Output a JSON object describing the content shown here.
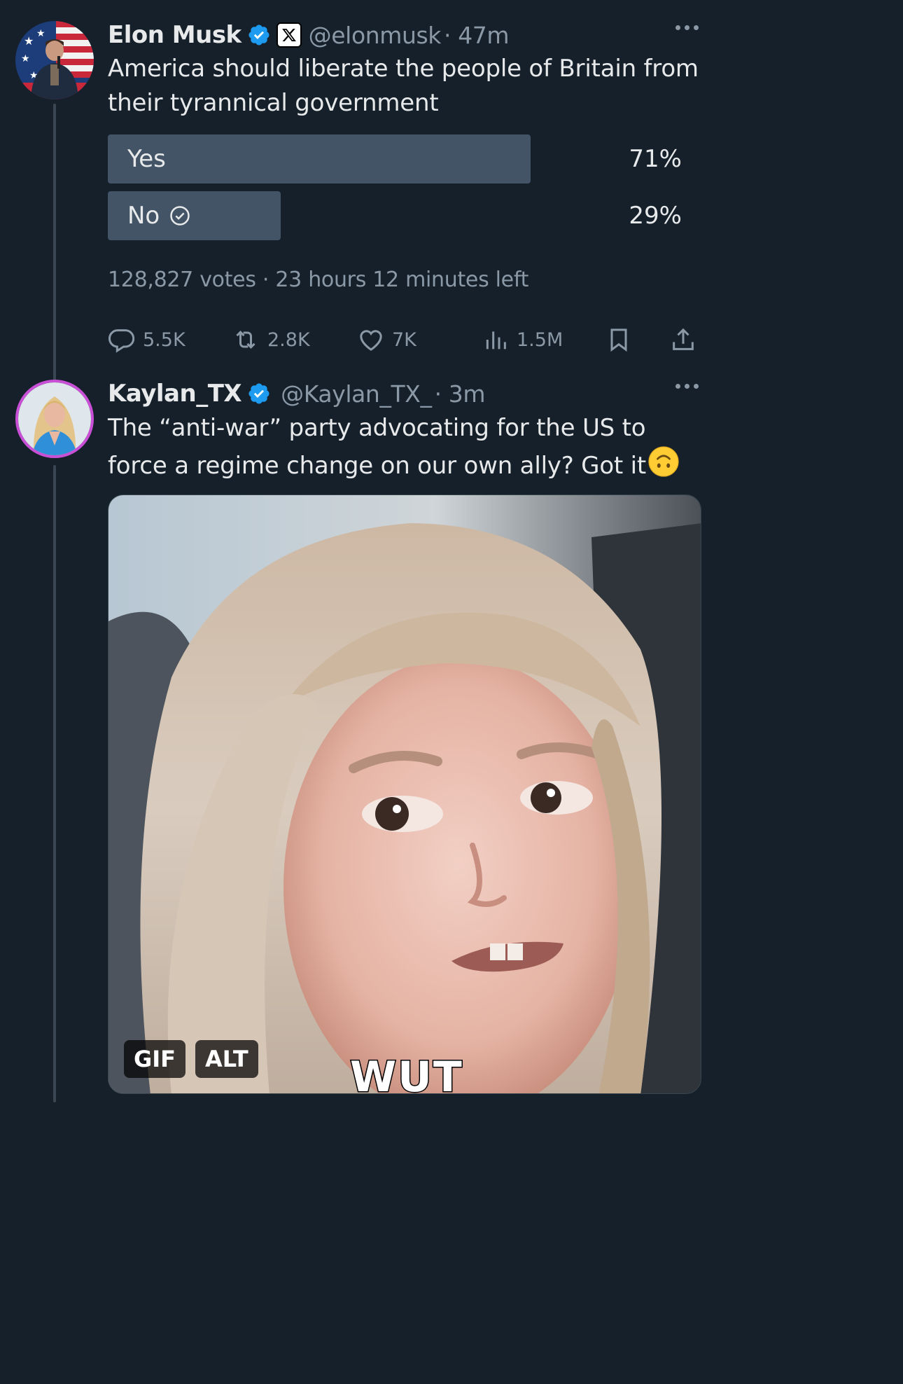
{
  "tweets": [
    {
      "name": "Elon Musk",
      "handle": "@elonmusk",
      "time": "· 47m",
      "text": "America should liberate the people of Britain from their tyrannical government",
      "poll": {
        "options": [
          {
            "label": "Yes",
            "percent_text": "71%",
            "share": 0.71,
            "selected": false
          },
          {
            "label": "No",
            "percent_text": "29%",
            "share": 0.29,
            "selected": true
          }
        ],
        "votes": "128,827 votes",
        "time_left": "· 23 hours 12 minutes left"
      },
      "actions": {
        "replies": "5.5K",
        "reposts": "2.8K",
        "likes": "7K",
        "views": "1.5M"
      }
    },
    {
      "name": "Kaylan_TX",
      "handle": "@Kaylan_TX_",
      "time": "· 3m",
      "text": "The “anti-war” party advocating for the US to force a regime change on our own ally? Got it",
      "emoji": "🙃",
      "media": {
        "gif_label": "GIF",
        "alt_label": "ALT",
        "caption": "WUT"
      }
    }
  ],
  "colors": {
    "background": "#15202b",
    "verified": "#1d9bf0",
    "secondary_text": "#8b98a5",
    "poll_bar": "#425466",
    "avatar_ring": "#c94fd6"
  }
}
